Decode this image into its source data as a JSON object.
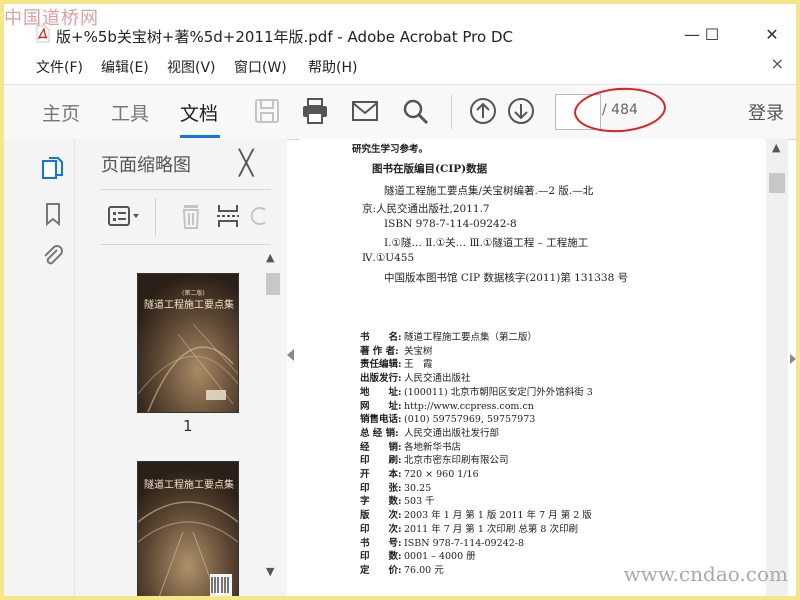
{
  "watermarks": {
    "top": "中国道桥网",
    "bottom": "www.cndao.com"
  },
  "window": {
    "title": "版+%5b关宝树+著%5d+2011年版.pdf - Adobe Acrobat Pro DC",
    "minimize": "—",
    "maximize": "☐",
    "close": "✕"
  },
  "menu": {
    "items": [
      "文件(F)",
      "编辑(E)",
      "视图(V)",
      "窗口(W)",
      "帮助(H)"
    ],
    "close": "×"
  },
  "toolbar": {
    "tabs": [
      "主页",
      "工具",
      "文档"
    ],
    "active_tab": "文档",
    "page_total": "/ 484",
    "login": "登录"
  },
  "panel": {
    "title": "页面缩略图",
    "close": "╳",
    "thumb1_num": "1",
    "cover_title": "隧道工程施工要点集",
    "cover_ed": "(第二版)"
  },
  "document": {
    "lines": [
      "研究生学习参考。",
      "图书在版编目(CIP)数据",
      "隧道工程施工要点集/关宝树编著.—2 版.—北",
      "京:人民交通出版社,2011.7",
      "ISBN  978-7-114-09242-8",
      "Ⅰ.①隧…  Ⅱ.①关…  Ⅲ.①隧道工程 – 工程施工",
      "Ⅳ.①U455",
      "中国版本图书馆 CIP 数据核字(2011)第 131338 号"
    ],
    "imprint": [
      {
        "label": "书　　名:",
        "value": "隧道工程施工要点集（第二版）"
      },
      {
        "label": "著  作  者:",
        "value": "关宝树"
      },
      {
        "label": "责任编辑:",
        "value": "王　霞"
      },
      {
        "label": "出版发行:",
        "value": "人民交通出版社"
      },
      {
        "label": "地　　址:",
        "value": "(100011)  北京市朝阳区安定门外外馆斜街 3"
      },
      {
        "label": "网　　址:",
        "value": "http://www.ccpress.com.cn"
      },
      {
        "label": "销售电话:",
        "value": "(010) 59757969, 59757973"
      },
      {
        "label": "总  经  销:",
        "value": "人民交通出版社发行部"
      },
      {
        "label": "经　　销:",
        "value": "各地新华书店"
      },
      {
        "label": "印　　刷:",
        "value": "北京市密东印刷有限公司"
      },
      {
        "label": "开　　本:",
        "value": "720 × 960   1/16"
      },
      {
        "label": "印　　张:",
        "value": "30.25"
      },
      {
        "label": "字　　数:",
        "value": "503 千"
      },
      {
        "label": "版　　次:",
        "value": "2003 年 1 月   第 1 版    2011 年 7 月    第 2 版"
      },
      {
        "label": "印　　次:",
        "value": "2011 年 7 月    第 1 次印刷    总第 8 次印刷"
      },
      {
        "label": "书　　号:",
        "value": "ISBN 978-7-114-09242-8"
      },
      {
        "label": "印　　数:",
        "value": "0001 – 4000 册"
      },
      {
        "label": "定　　价:",
        "value": "76.00 元"
      }
    ]
  }
}
